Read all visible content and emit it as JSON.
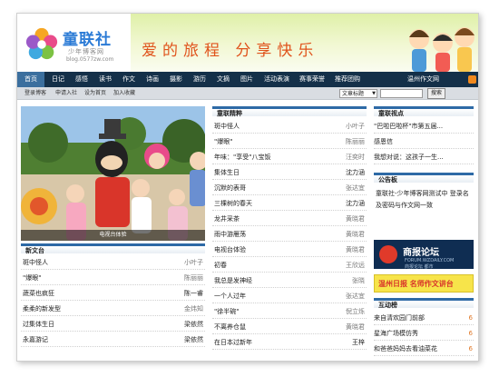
{
  "header": {
    "logo_title": "童联社",
    "logo_subtitle": "少年博客网",
    "logo_url": "blog.0577zw.com",
    "slogan": "爱的旅程 分享快乐"
  },
  "nav": {
    "items": [
      "首页",
      "日记",
      "感悟",
      "读书",
      "作文",
      "诗画",
      "摄影",
      "游历",
      "文摘",
      "图片",
      "活动表演",
      "赛事荣誉",
      "推荐团购",
      "温州作文网"
    ]
  },
  "subnav": {
    "links": [
      "登录博客",
      "申请入社",
      "设为首页",
      "加入收藏"
    ],
    "search_select": "文章标题",
    "search_button": "搜索"
  },
  "photo": {
    "caption": "电视台体验"
  },
  "new_articles": {
    "title": "新文台",
    "items": [
      {
        "title": "斑中怪人",
        "author": "小叶子"
      },
      {
        "title": "\"爆眼\"",
        "author": "陈丽丽"
      },
      {
        "title": "蔬菜也疯狂",
        "author": "陈一睿"
      },
      {
        "title": "柔柔的新发型",
        "author": "金炜知"
      },
      {
        "title": "过集体生日",
        "author": "梁依然"
      },
      {
        "title": "永嘉游记",
        "author": "梁依然"
      }
    ]
  },
  "featured": {
    "title": "童联精粹",
    "items": [
      {
        "title": "斑中怪人",
        "author": "小叶子"
      },
      {
        "title": "\"爆眼\"",
        "author": "陈丽丽"
      },
      {
        "title": "年味：\"享受\"八宝饭",
        "author": "汪奕时"
      },
      {
        "title": "集体生日",
        "author": "沈力涵"
      },
      {
        "title": "沉默的表哥",
        "author": "张达宜"
      },
      {
        "title": "三棵树的春天",
        "author": "沈力涵"
      },
      {
        "title": "龙井采茶",
        "author": "黄晓君"
      },
      {
        "title": "雨中游雁荡",
        "author": "黄晓君"
      },
      {
        "title": "电视台体验",
        "author": "黄晓君"
      },
      {
        "title": "初春",
        "author": "王欣远"
      },
      {
        "title": "我总是发神经",
        "author": "张晓"
      },
      {
        "title": "一个人过年",
        "author": "张达宜"
      },
      {
        "title": "\"徐半碗\"",
        "author": "倪立烁"
      },
      {
        "title": "不离养仓鼠",
        "author": "黄晓君"
      },
      {
        "title": "在日本过新年",
        "author": "王梓"
      }
    ]
  },
  "hot": {
    "title": "童联视点",
    "items": [
      "\"巴啦巴啦杯\"市第五届...",
      "感恩信",
      "我想对说：这孩子一生..."
    ]
  },
  "notice": {
    "title": "公告板",
    "text": "童联社-少年博客网测试中 登录名及密码与作文网一致"
  },
  "ads": {
    "forum_title": "商报论坛",
    "forum_url": "FORUM.WZDAILY.COM",
    "forum_sub": "商报论坛 都市",
    "daily_text": "温州日报 名师作文讲台"
  },
  "interaction": {
    "title": "互动榜",
    "items": [
      {
        "title": "来自清欢园门前部",
        "count": "6"
      },
      {
        "title": "星海广场模仿秀",
        "count": "6"
      },
      {
        "title": "和爸爸妈妈去看油菜花",
        "count": "6"
      }
    ]
  },
  "colors": {
    "nav_bg": "#143049",
    "accent_blue": "#2e6aa6",
    "slogan": "#e0531c"
  }
}
